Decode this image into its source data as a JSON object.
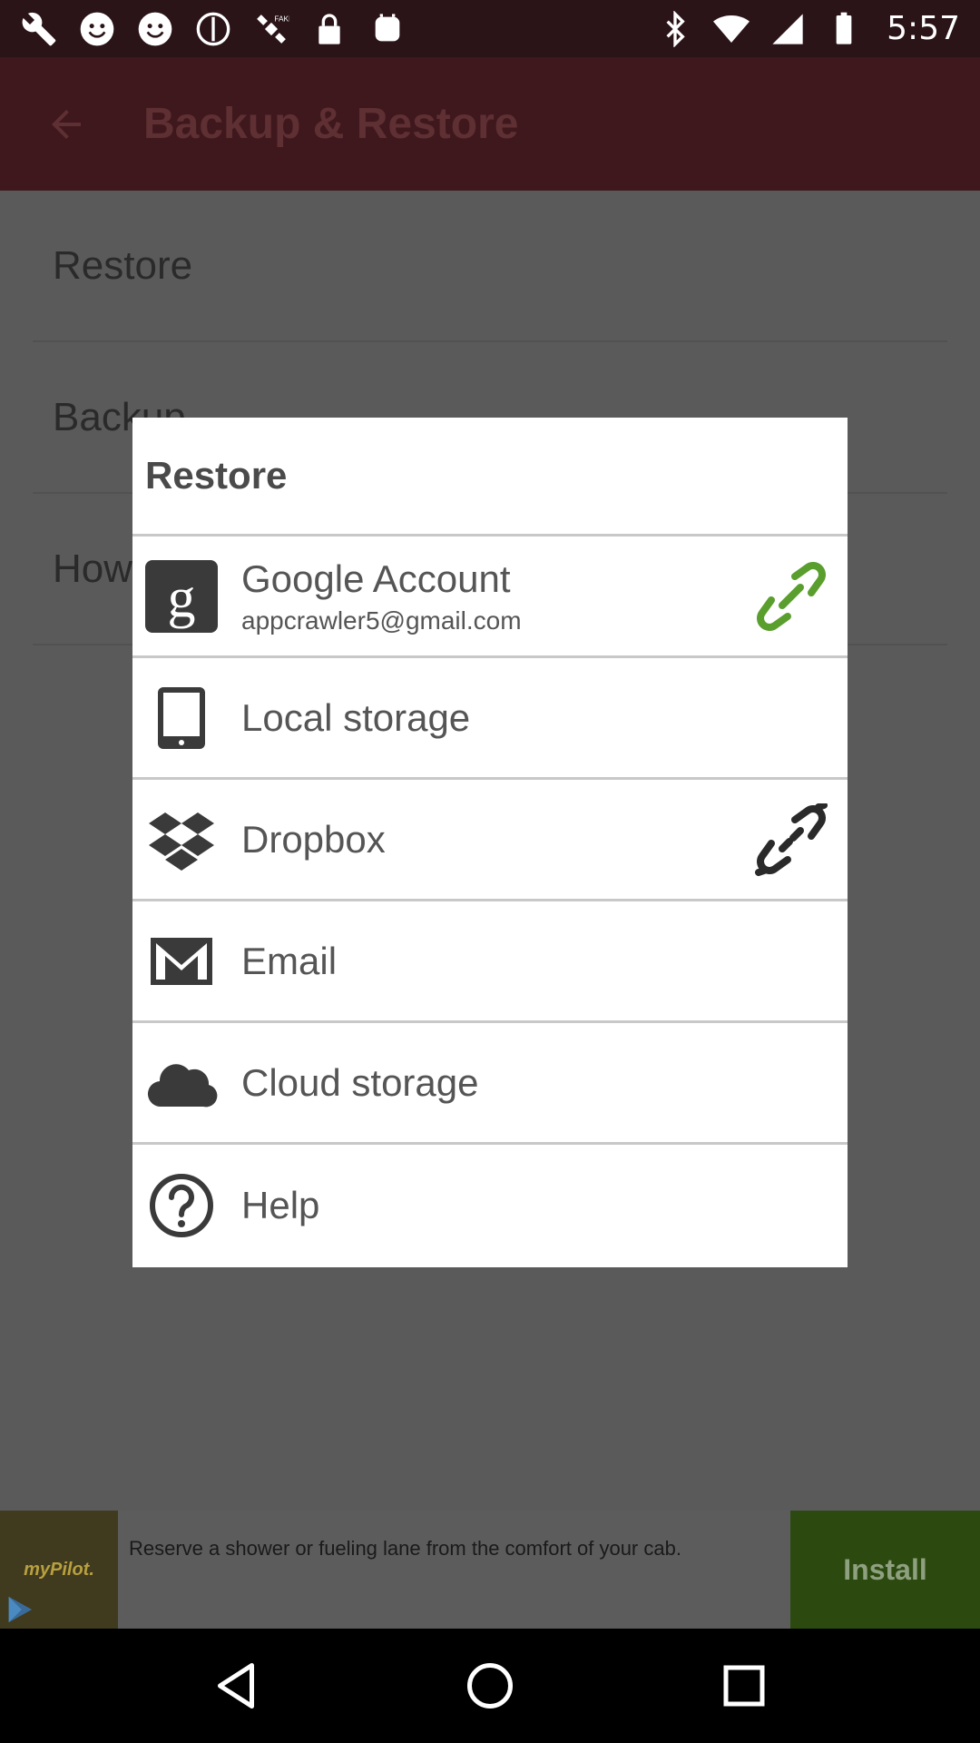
{
  "status_bar": {
    "time": "5:57",
    "icons": [
      "wrench-icon",
      "smiley-icon",
      "smiley-icon",
      "do-not-disturb-icon",
      "fake-gps-icon",
      "lock-icon",
      "android-icon"
    ],
    "right_icons": [
      "bluetooth-icon",
      "wifi-icon",
      "signal-icon",
      "battery-icon"
    ]
  },
  "app_bar": {
    "title": "Backup & Restore"
  },
  "background_list": {
    "items": [
      "Restore",
      "Backup",
      "How"
    ]
  },
  "dialog": {
    "title": "Restore",
    "options": [
      {
        "label": "Google Account",
        "sublabel": "appcrawler5@gmail.com",
        "icon": "google-icon",
        "status": "linked"
      },
      {
        "label": "Local storage",
        "icon": "tablet-icon"
      },
      {
        "label": "Dropbox",
        "icon": "dropbox-icon",
        "status": "unlinked"
      },
      {
        "label": "Email",
        "icon": "mail-icon"
      },
      {
        "label": "Cloud storage",
        "icon": "cloud-icon"
      },
      {
        "label": "Help",
        "icon": "help-icon"
      }
    ]
  },
  "ad": {
    "brand": "myPilot.",
    "text": "Reserve a shower or fueling lane from the comfort of your cab.",
    "button": "Install"
  },
  "colors": {
    "accent_linked": "#5a9e2e",
    "icon_dark": "#3a3a3a",
    "app_bar": "#3f181d"
  }
}
